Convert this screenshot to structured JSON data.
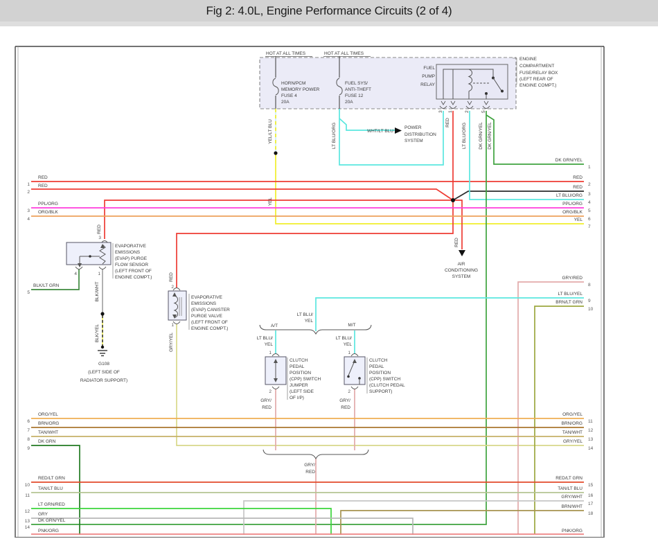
{
  "page": {
    "title": "Fig 2: 4.0L, Engine Performance Circuits (2 of 4)"
  },
  "colors": {
    "red": "#ee3b33",
    "black_wire": "#2b2b2b",
    "ppl_org": "#ff3ddd",
    "org_blk": "#eda159",
    "yel": "#f0ee2a",
    "lt_blu": "#5ae7df",
    "dk_grn_yel": "#3ea23e",
    "blk_lt_grn": "#3f8a3f",
    "gry_yel": "#d8d88a",
    "gry_red": "#e2aaaa",
    "org_yel": "#efae52",
    "brn_org": "#a9762f",
    "tan_wht": "#c6b067",
    "dk_grn": "#227a22",
    "red_lt_grn": "#e34a2a",
    "tan_lt_blu": "#b5c493",
    "lt_grn_red": "#3bd53b",
    "gry": "#b8b8b8",
    "gry_wht": "#c6c6c6",
    "brn_wht": "#a6934f",
    "brn_lt_grn": "#9ca73e",
    "pnk_org": "#ee8282",
    "box_fill": "#ebebf7"
  },
  "fusebox": {
    "hot1": "HOT AT ALL TIMES",
    "hot2": "HOT AT ALL TIMES",
    "fuse4": [
      "HORN/PCM",
      "MEMORY POWER",
      "FUSE 4",
      "20A"
    ],
    "fuse12": [
      "FUEL SYS/",
      "ANTI-THEFT",
      "FUSE 12",
      "20A"
    ],
    "relay": [
      "FUEL",
      "PUMP",
      "RELAY"
    ],
    "box_label": [
      "ENGINE",
      "COMPARTMENT",
      "FUSE/RELAY BOX",
      "(LEFT REAR OF",
      "ENGINE COMPT.)"
    ],
    "pins": [
      "3",
      "1",
      "2",
      "5"
    ]
  },
  "wl": {
    "yel_lt_blu": "YEL/LT BLU",
    "yel": "YEL",
    "lt_blu_org": "LT BLU/ORG",
    "wht_lt_blu": "WHT/LT BLU",
    "red": "RED",
    "dk_grn_yel": "DK GRN/YEL",
    "blk_wht": "BLK/WHT",
    "blk_yel": "BLK/YEL",
    "gry_yel": "GRY/YEL",
    "gry_slash": "GRY/",
    "red_part": "RED",
    "lt_blu_slash": "LT BLU/",
    "yel_part": "YEL"
  },
  "systems": {
    "power_dist": [
      "POWER",
      "DISTRIBUTION",
      "SYSTEM"
    ],
    "ac": [
      "AIR",
      "CONDITIONING",
      "SYSTEM"
    ]
  },
  "components": {
    "evap_sensor": [
      "EVAPORATIVE",
      "EMISSIONS",
      "(EVAP) PURGE",
      "FLOW SENSOR",
      "(LEFT FRONT OF",
      "ENGINE COMPT.)"
    ],
    "evap_valve": [
      "EVAPORATIVE",
      "EMISSIONS",
      "(EVAP) CANISTER",
      "PURGE VALVE",
      "(LEFT FRONT OF",
      "ENGINE COMPT.)"
    ],
    "cpp_jumper": [
      "CLUTCH",
      "PEDAL",
      "POSITION",
      "(CPP) SWITCH",
      "JUMPER",
      "(LEFT SIDE",
      "OF I/P)"
    ],
    "cpp_switch": [
      "CLUTCH",
      "PEDAL",
      "POSITION",
      "(CPP) SWITCH",
      "(CLUTCH PEDAL",
      "SUPPORT)"
    ],
    "ground": [
      "G108",
      "(LEFT SIDE OF",
      "RADIATOR SUPPORT)"
    ],
    "at": "A/T",
    "mt": "M/T"
  },
  "pin_numbers": {
    "one": "1",
    "two": "2",
    "three": "3",
    "four": "4"
  },
  "left_rows": [
    {
      "n": "1",
      "label": "RED"
    },
    {
      "n": "2",
      "label": "RED"
    },
    {
      "n": "3",
      "label": "PPL/ORG"
    },
    {
      "n": "4",
      "label": "ORG/BLK"
    },
    {
      "n": "5",
      "label": "BLK/LT GRN"
    },
    {
      "n": "6",
      "label": "ORG/YEL"
    },
    {
      "n": "7",
      "label": "BRN/ORG"
    },
    {
      "n": "8",
      "label": "TAN/WHT"
    },
    {
      "n": "9",
      "label": "DK GRN"
    },
    {
      "n": "10",
      "label": "RED/LT GRN"
    },
    {
      "n": "11",
      "label": "TAN/LT BLU"
    },
    {
      "n": "12",
      "label": "LT GRN/RED"
    },
    {
      "n": "13",
      "label": "GRY"
    },
    {
      "n": "14",
      "label": "DK GRN/YEL"
    },
    {
      "n": "",
      "label": "PNK/ORG"
    }
  ],
  "right_rows": [
    {
      "n": "1",
      "label": "DK GRN/YEL"
    },
    {
      "n": "2",
      "label": "RED"
    },
    {
      "n": "3",
      "label": "RED"
    },
    {
      "n": "4",
      "label": "LT BLU/ORG"
    },
    {
      "n": "5",
      "label": "PPL/ORG"
    },
    {
      "n": "6",
      "label": "ORG/BLK"
    },
    {
      "n": "7",
      "label": "YEL"
    },
    {
      "n": "8",
      "label": "GRY/RED"
    },
    {
      "n": "9",
      "label": "LT BLU/YEL"
    },
    {
      "n": "10",
      "label": "BRN/LT GRN"
    },
    {
      "n": "11",
      "label": "ORG/YEL"
    },
    {
      "n": "12",
      "label": "BRN/ORG"
    },
    {
      "n": "13",
      "label": "TAN/WHT"
    },
    {
      "n": "14",
      "label": "GRY/YEL"
    },
    {
      "n": "15",
      "label": "RED/LT GRN"
    },
    {
      "n": "16",
      "label": "TAN/LT BLU"
    },
    {
      "n": "17",
      "label": "GRY/WHT"
    },
    {
      "n": "18",
      "label": "BRN/WHT"
    },
    {
      "n": "",
      "label": "PNK/ORG"
    }
  ]
}
